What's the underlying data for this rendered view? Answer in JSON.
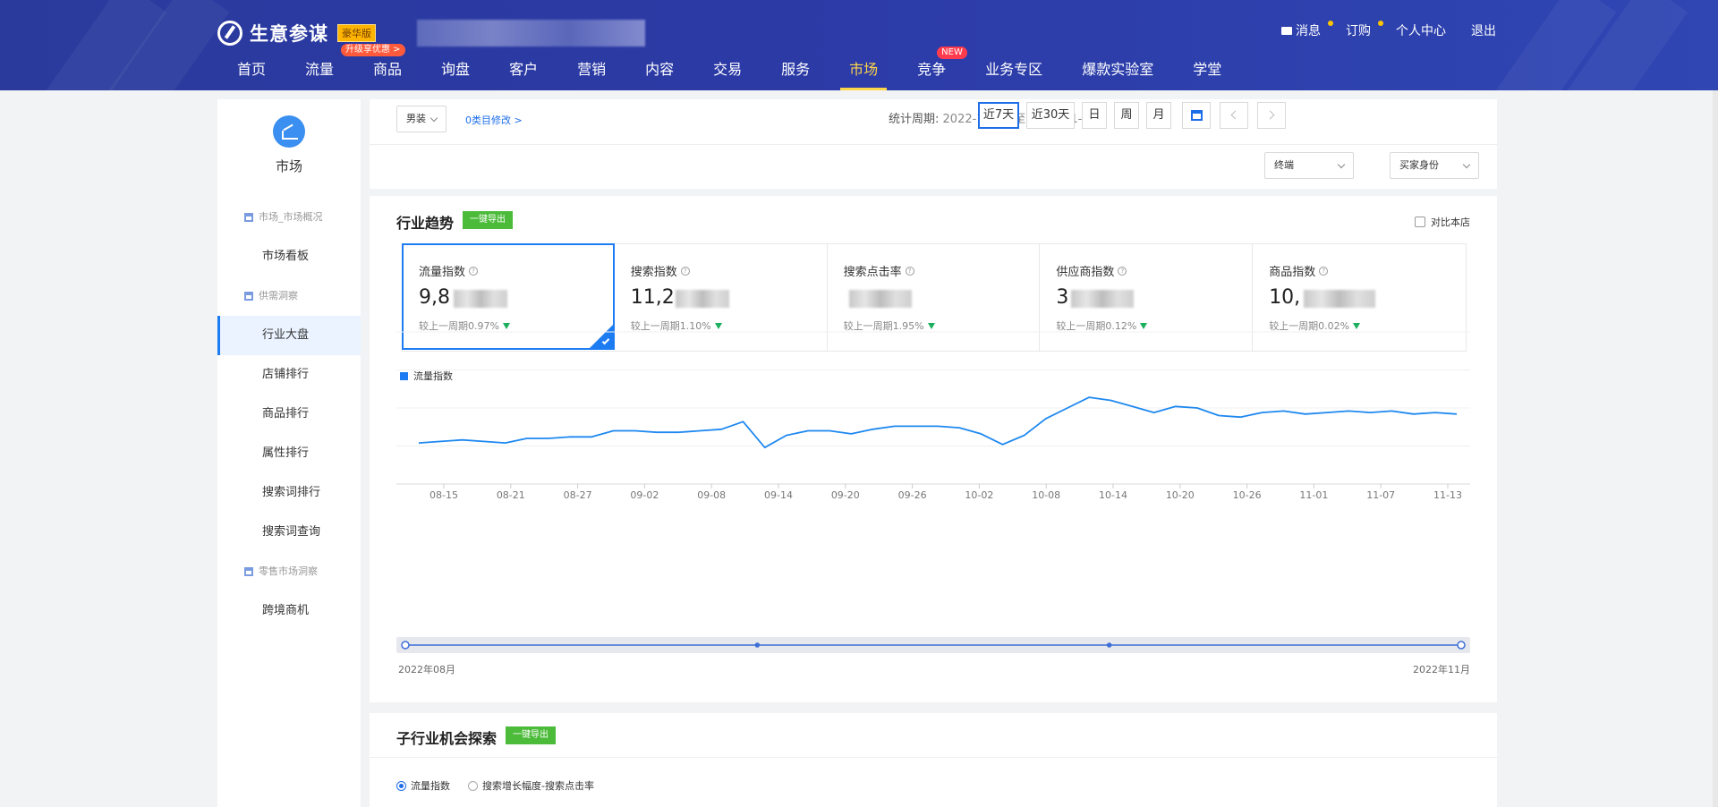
{
  "header": {
    "logo_text": "生意参谋",
    "edition": "豪华版",
    "upgrade_tag": "升级享优惠 >",
    "top_links": [
      {
        "label": "消息",
        "dot": true
      },
      {
        "label": "订购",
        "dot": true
      },
      {
        "label": "个人中心",
        "dot": false
      },
      {
        "label": "退出",
        "dot": false
      }
    ],
    "nav": [
      {
        "label": "首页"
      },
      {
        "label": "流量"
      },
      {
        "label": "商品"
      },
      {
        "label": "询盘"
      },
      {
        "label": "客户"
      },
      {
        "label": "营销"
      },
      {
        "label": "内容"
      },
      {
        "label": "交易"
      },
      {
        "label": "服务"
      },
      {
        "label": "市场",
        "active": true
      },
      {
        "label": "竞争",
        "badge": "NEW"
      },
      {
        "label": "业务专区"
      },
      {
        "label": "爆款实验室"
      },
      {
        "label": "学堂"
      }
    ]
  },
  "sidebar": {
    "title": "市场",
    "groups": [
      {
        "label": "市场_市场概况",
        "items": [
          {
            "label": "市场看板"
          }
        ]
      },
      {
        "label": "供需洞察",
        "items": [
          {
            "label": "行业大盘",
            "active": true
          },
          {
            "label": "店铺排行"
          },
          {
            "label": "商品排行"
          },
          {
            "label": "属性排行"
          },
          {
            "label": "搜索词排行"
          },
          {
            "label": "搜索词查询"
          }
        ]
      },
      {
        "label": "零售市场洞察",
        "items": [
          {
            "label": "跨境商机"
          }
        ]
      }
    ]
  },
  "filters": {
    "category": "男装",
    "edit_category": "0类目修改 >",
    "period_label": "统计周期:",
    "period_range": "2022-11-07 至 2022-11-13",
    "period_buttons": [
      "近7天",
      "近30天",
      "日",
      "周",
      "月"
    ],
    "active_period": "近7天",
    "terminal": "终端",
    "buyer_identity": "买家身份"
  },
  "trend": {
    "title": "行业趋势",
    "export_label": "一键导出",
    "compare_label": "对比本店",
    "metrics": [
      {
        "name": "流量指数",
        "value_prefix": "9,8",
        "delta": "较上一周期0.97%",
        "active": true
      },
      {
        "name": "搜索指数",
        "value_prefix": "11,2",
        "delta": "较上一周期1.10%"
      },
      {
        "name": "搜索点击率",
        "value_prefix": "",
        "delta": "较上一周期1.95%"
      },
      {
        "name": "供应商指数",
        "value_prefix": "3",
        "delta": "较上一周期0.12%"
      },
      {
        "name": "商品指数",
        "value_prefix": "10,",
        "delta": "较上一周期0.02%"
      }
    ],
    "legend": "流量指数",
    "range_start": "2022年08月",
    "range_end": "2022年11月"
  },
  "chart_data": {
    "type": "line",
    "x": [
      "08-10",
      "08-12",
      "08-14",
      "08-16",
      "08-18",
      "08-20",
      "08-22",
      "08-24",
      "08-26",
      "08-28",
      "08-30",
      "09-01",
      "09-03",
      "09-05",
      "09-07",
      "09-09",
      "09-11",
      "09-13",
      "09-15",
      "09-17",
      "09-19",
      "09-21",
      "09-23",
      "09-25",
      "09-27",
      "09-29",
      "10-01",
      "10-03",
      "10-05",
      "10-07",
      "10-09",
      "10-11",
      "10-13",
      "10-15",
      "10-17",
      "10-19",
      "10-21",
      "10-23",
      "10-25",
      "10-27",
      "10-29",
      "10-31",
      "11-02",
      "11-04",
      "11-06",
      "11-08",
      "11-10",
      "11-12",
      "11-13"
    ],
    "series": [
      {
        "name": "流量指数",
        "values": [
          27,
          28,
          29,
          28,
          27,
          30,
          30,
          31,
          31,
          35,
          35,
          34,
          34,
          35,
          36,
          41,
          24,
          32,
          35,
          35,
          33,
          36,
          38,
          38,
          38,
          37,
          33,
          26,
          32,
          43,
          50,
          57,
          55,
          51,
          47,
          51,
          50,
          45,
          44,
          47,
          48,
          46,
          47,
          48,
          47,
          48,
          46,
          47,
          46
        ]
      }
    ],
    "x_ticks": [
      "08-15",
      "08-21",
      "08-27",
      "09-02",
      "09-08",
      "09-14",
      "09-20",
      "09-26",
      "10-02",
      "10-08",
      "10-14",
      "10-20",
      "10-26",
      "11-01",
      "11-07",
      "11-13"
    ],
    "ylim": [
      0,
      100
    ],
    "grid": true,
    "legend_position": "top-left"
  },
  "sub_industry": {
    "title": "子行业机会探索",
    "export_label": "一键导出",
    "options": [
      {
        "label": "流量指数",
        "checked": true
      },
      {
        "label": "搜索增长幅度-搜索点击率",
        "checked": false
      }
    ]
  }
}
